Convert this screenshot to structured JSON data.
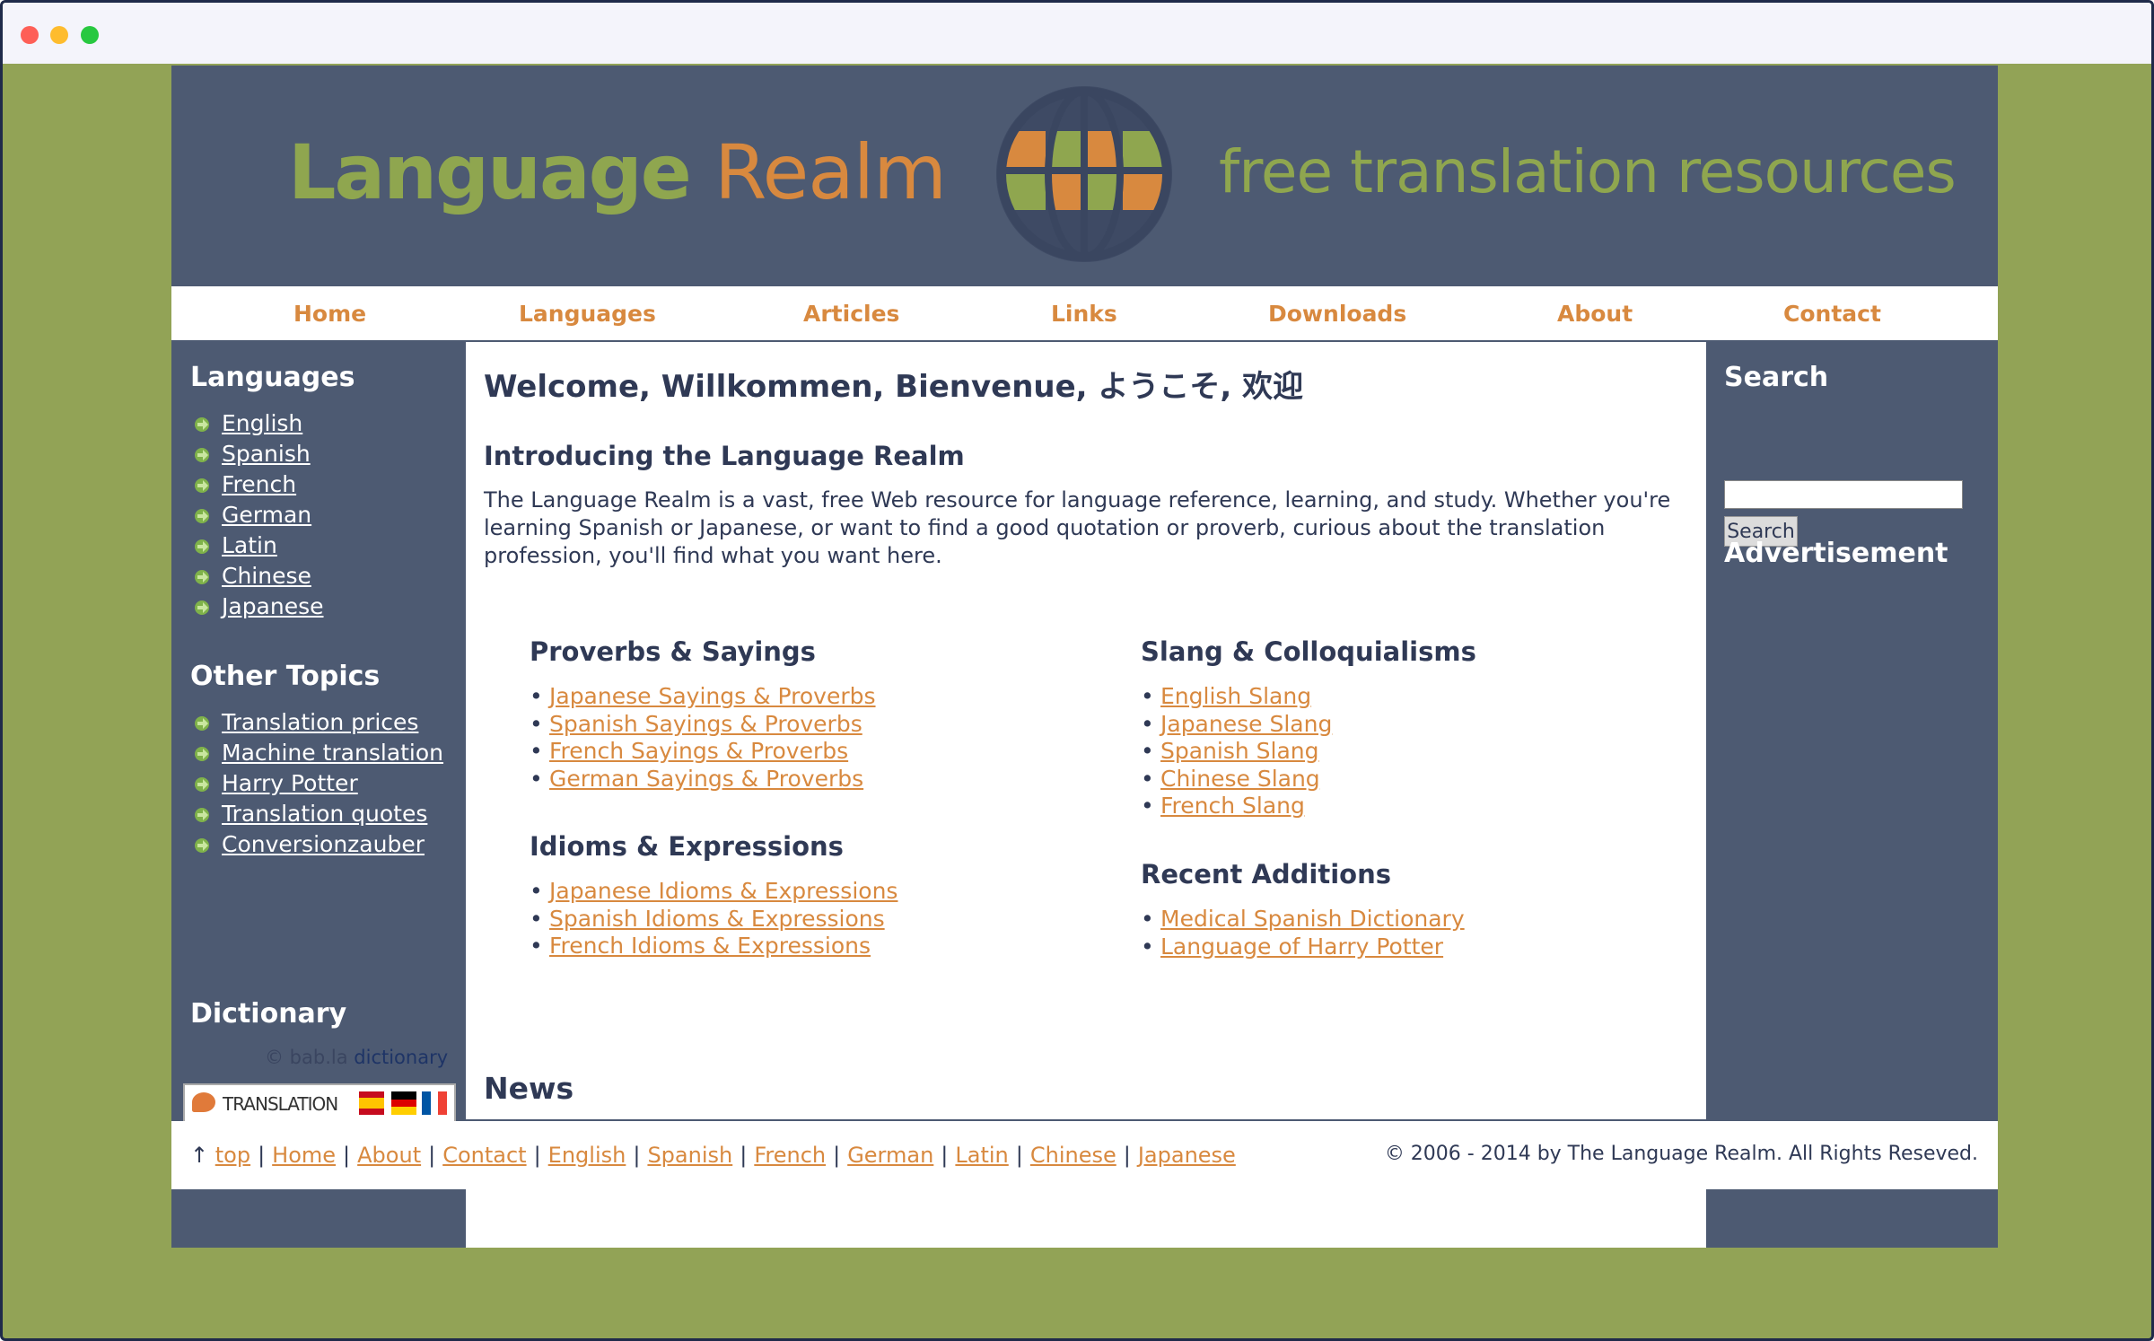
{
  "colors": {
    "accent": "#d8893f",
    "brand_green": "#8fa64f",
    "panel": "#4d5a72",
    "text": "#2f3955",
    "outer_bg": "#92a356"
  },
  "banner": {
    "logo_word1": "Language",
    "logo_word2": "Realm",
    "tagline": "free translation resources"
  },
  "nav": [
    {
      "label": "Home"
    },
    {
      "label": "Languages"
    },
    {
      "label": "Articles"
    },
    {
      "label": "Links"
    },
    {
      "label": "Downloads"
    },
    {
      "label": "About"
    },
    {
      "label": "Contact"
    }
  ],
  "sidebar": {
    "languages_heading": "Languages",
    "languages": [
      "English",
      "Spanish",
      "French",
      "German",
      "Latin",
      "Chinese",
      "Japanese"
    ],
    "other_heading": "Other Topics",
    "other": [
      "Translation prices",
      "Machine translation",
      "Harry Potter",
      "Translation quotes",
      "Conversionzauber"
    ],
    "dictionary_heading": "Dictionary",
    "bab_prefix": "© bab.la",
    "bab_link": "dictionary",
    "translation_badge": "TRANSLATION"
  },
  "main": {
    "welcome": "Welcome, Willkommen, Bienvenue, ようこそ, 欢迎",
    "intro_heading": "Introducing the Language Realm",
    "intro_text": "The Language Realm is a vast, free Web resource for language reference, learning, and study. Whether you're learning Spanish or Japanese, or want to find a good quotation or proverb, curious about the translation profession, you'll find what you want here.",
    "sections": {
      "proverbs": {
        "heading": "Proverbs & Sayings",
        "items": [
          "Japanese Sayings & Proverbs",
          "Spanish Sayings & Proverbs",
          "French Sayings & Proverbs",
          "German Sayings & Proverbs"
        ]
      },
      "idioms": {
        "heading": "Idioms & Expressions",
        "items": [
          "Japanese Idioms & Expressions",
          "Spanish Idioms & Expressions",
          "French Idioms & Expressions"
        ]
      },
      "slang": {
        "heading": "Slang & Colloquialisms",
        "items": [
          "English Slang",
          "Japanese Slang",
          "Spanish Slang",
          "Chinese Slang",
          "French Slang"
        ]
      },
      "recent": {
        "heading": "Recent Additions",
        "items": [
          "Medical Spanish Dictionary",
          "Language of Harry Potter"
        ]
      }
    },
    "news_heading": "News",
    "top_arrow": "↑",
    "top_link": "top"
  },
  "right": {
    "search_heading": "Search",
    "search_value": "",
    "search_button": "Search",
    "ad_heading": "Advertisement"
  },
  "footer": {
    "arrow": "↑",
    "links": [
      "top",
      "Home",
      "About",
      "Contact",
      "English",
      "Spanish",
      "French",
      "German",
      "Latin",
      "Chinese",
      "Japanese"
    ],
    "separator": "|",
    "copyright": "© 2006 - 2014 by The Language Realm. All Rights Reseved."
  }
}
